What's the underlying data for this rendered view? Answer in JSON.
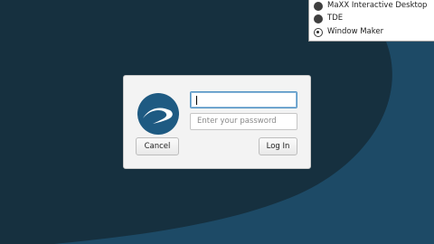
{
  "session_menu": {
    "items": [
      {
        "label": "MaXX Interactive Desktop",
        "selected": false
      },
      {
        "label": "TDE",
        "selected": false
      },
      {
        "label": "Window Maker",
        "selected": true
      }
    ]
  },
  "login": {
    "username_value": "",
    "password_placeholder": "Enter your password",
    "cancel_label": "Cancel",
    "login_label": "Log In"
  },
  "colors": {
    "background_dark": "#16303f",
    "background_swoosh": "#1d4a66",
    "logo_blue": "#1e5a82",
    "focus_border": "#5294c4"
  },
  "icons": {
    "logo": "swoosh-logo-icon",
    "radio_unchecked": "radio-unchecked-icon",
    "radio_checked": "radio-checked-icon"
  }
}
